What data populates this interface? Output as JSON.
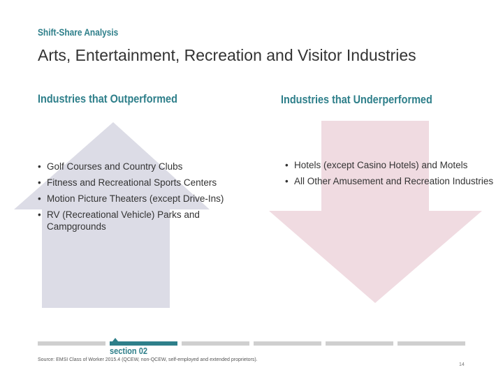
{
  "kicker": "Shift-Share Analysis",
  "title": "Arts, Entertainment, Recreation and Visitor Industries",
  "outperformed": {
    "heading": "Industries that Outperformed",
    "items": [
      "Golf Courses and Country Clubs",
      "Fitness and Recreational Sports Centers",
      "Motion Picture Theaters (except Drive-Ins)",
      "RV (Recreational Vehicle) Parks and Campgrounds"
    ]
  },
  "underperformed": {
    "heading": "Industries that Underperformed",
    "items": [
      "Hotels (except Casino Hotels) and Motels",
      "All Other Amusement and Recreation Industries"
    ]
  },
  "footer": {
    "section": "section 02",
    "source": "Source: EMSI Class of Worker 2015.4 (QCEW, non-QCEW, self-employed and extended proprietors).",
    "page": "14"
  },
  "colors": {
    "teal": "#2e7f8a",
    "up_arrow": "#dcdce6",
    "down_arrow": "#f0dbe1"
  }
}
